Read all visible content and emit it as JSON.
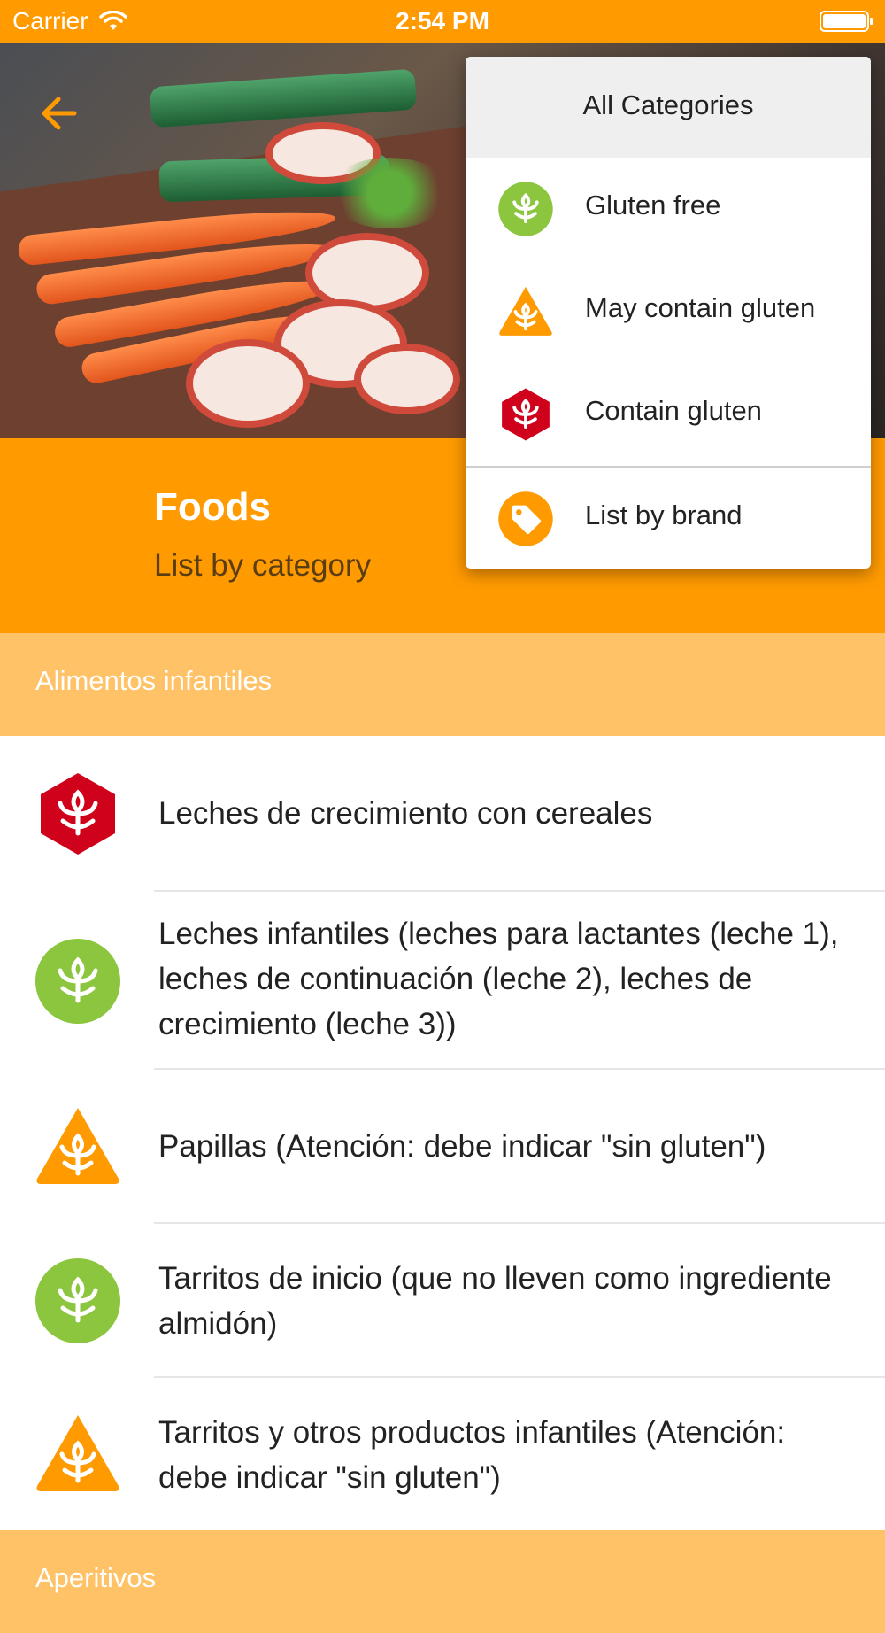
{
  "status_bar": {
    "carrier": "Carrier",
    "time": "2:54 PM"
  },
  "header": {
    "title": "Foods",
    "subtitle": "List by category"
  },
  "menu": {
    "header": "All Categories",
    "items": [
      {
        "label": "Gluten free",
        "icon": "gluten-free-icon"
      },
      {
        "label": "May contain gluten",
        "icon": "may-contain-gluten-icon"
      },
      {
        "label": "Contain gluten",
        "icon": "contains-gluten-icon"
      }
    ],
    "brand_item": {
      "label": "List by brand",
      "icon": "tag-icon"
    }
  },
  "sections": [
    {
      "title": "Alimentos infantiles",
      "items": [
        {
          "status": "contains",
          "label": "Leches de crecimiento con cereales"
        },
        {
          "status": "free",
          "label": "Leches infantiles (leches para lactantes (leche 1), leches de continuación (leche 2), leches de crecimiento (leche 3))"
        },
        {
          "status": "may",
          "label": "Papillas (Atención: debe indicar \"sin gluten\")"
        },
        {
          "status": "free",
          "label": "Tarritos de inicio (que no lleven como ingrediente almidón)"
        },
        {
          "status": "may",
          "label": "Tarritos y otros productos infantiles (Atención: debe indicar \"sin gluten\")"
        }
      ]
    },
    {
      "title": "Aperitivos"
    }
  ],
  "colors": {
    "accent": "#FF9A00",
    "section_bg": "#FFC266",
    "gluten_free": "#8CC63E",
    "may_contain": "#FF9A00",
    "contains": "#D0021B"
  }
}
